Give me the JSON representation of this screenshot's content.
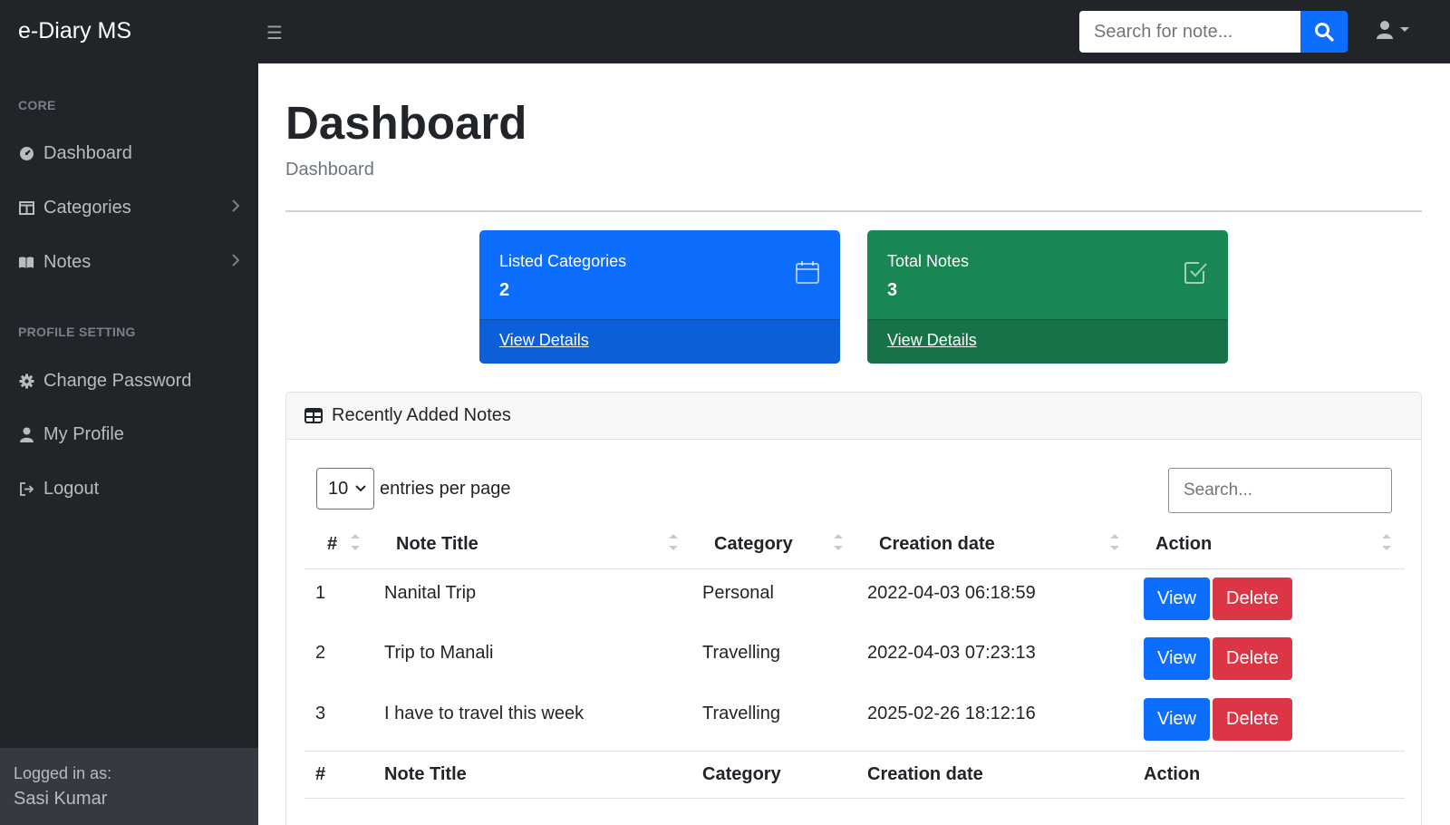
{
  "brand": "e-Diary MS",
  "search": {
    "placeholder": "Search for note..."
  },
  "sidebar": {
    "headings": [
      "CORE",
      "PROFILE SETTING"
    ],
    "items": [
      {
        "label": "Dashboard",
        "icon": "dashboard-icon"
      },
      {
        "label": "Categories",
        "icon": "columns-icon"
      },
      {
        "label": "Notes",
        "icon": "book-icon"
      },
      {
        "label": "Change Password",
        "icon": "gear-icon"
      },
      {
        "label": "My Profile",
        "icon": "user-icon"
      },
      {
        "label": "Logout",
        "icon": "logout-icon"
      }
    ],
    "footer": {
      "logged_in_as": "Logged in as:",
      "name": "Sasi Kumar"
    }
  },
  "page": {
    "title": "Dashboard",
    "breadcrumb": "Dashboard"
  },
  "cards": [
    {
      "label": "Listed Categories",
      "value": "2",
      "link": "View Details",
      "color": "#0d6efd",
      "icon": "calendar-icon"
    },
    {
      "label": "Total Notes",
      "value": "3",
      "link": "View Details",
      "color": "#198754",
      "icon": "check-square-icon"
    }
  ],
  "panel": {
    "title": "Recently Added Notes",
    "length_value": "10",
    "length_label": "entries per page",
    "search_placeholder": "Search...",
    "columns": [
      "#",
      "Note Title",
      "Category",
      "Creation date",
      "Action"
    ],
    "rows": [
      {
        "num": "1",
        "title": "Nanital Trip",
        "category": "Personal",
        "date": "2022-04-03 06:18:59"
      },
      {
        "num": "2",
        "title": "Trip to Manali",
        "category": "Travelling",
        "date": "2022-04-03 07:23:13"
      },
      {
        "num": "3",
        "title": "I have to travel this week",
        "category": "Travelling",
        "date": "2025-02-26 18:12:16"
      }
    ],
    "view_label": "View",
    "delete_label": "Delete"
  }
}
